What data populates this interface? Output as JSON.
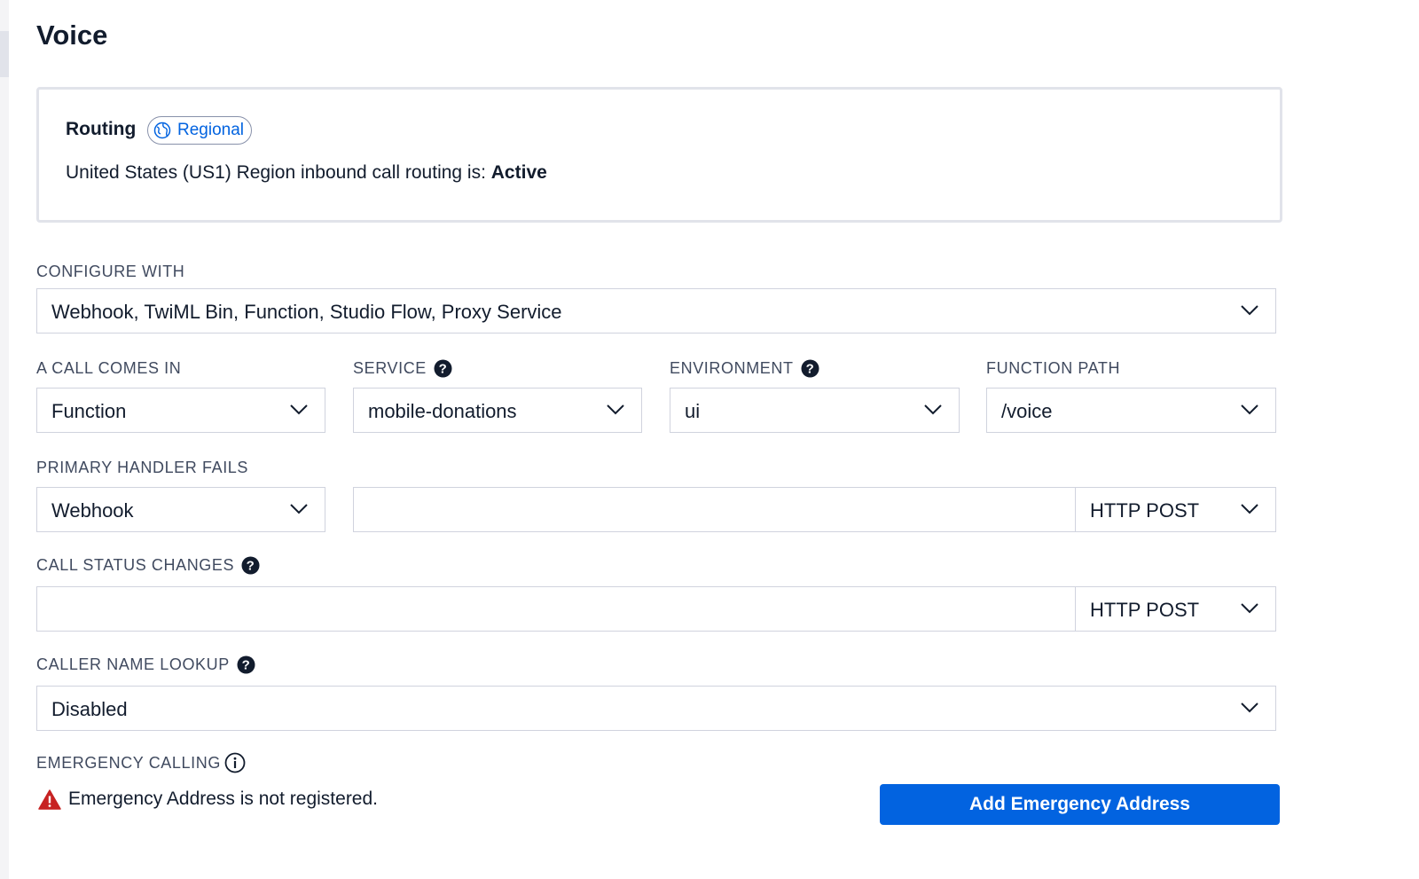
{
  "page": {
    "title": "Voice"
  },
  "routing": {
    "title": "Routing",
    "badge": "Regional",
    "status_prefix": "United States (US1) Region inbound call routing is: ",
    "status_value": "Active"
  },
  "configure_with": {
    "label": "CONFIGURE WITH",
    "value": "Webhook, TwiML Bin, Function, Studio Flow, Proxy Service"
  },
  "call_comes_in": {
    "label": "A CALL COMES IN",
    "value": "Function"
  },
  "service": {
    "label": "SERVICE",
    "value": "mobile-donations"
  },
  "environment": {
    "label": "ENVIRONMENT",
    "value": "ui"
  },
  "function_path": {
    "label": "FUNCTION PATH",
    "value": "/voice"
  },
  "primary_handler": {
    "label": "PRIMARY HANDLER FAILS",
    "type_value": "Webhook",
    "url_value": "",
    "method": "HTTP POST"
  },
  "call_status": {
    "label": "CALL STATUS CHANGES",
    "url_value": "",
    "method": "HTTP POST"
  },
  "caller_name": {
    "label": "CALLER NAME LOOKUP",
    "value": "Disabled"
  },
  "emergency": {
    "label": "EMERGENCY CALLING",
    "warning": "Emergency Address is not registered.",
    "button": "Add Emergency Address"
  },
  "colors": {
    "primary": "#0263e0",
    "warning": "#c72323",
    "text": "#121c2d"
  }
}
